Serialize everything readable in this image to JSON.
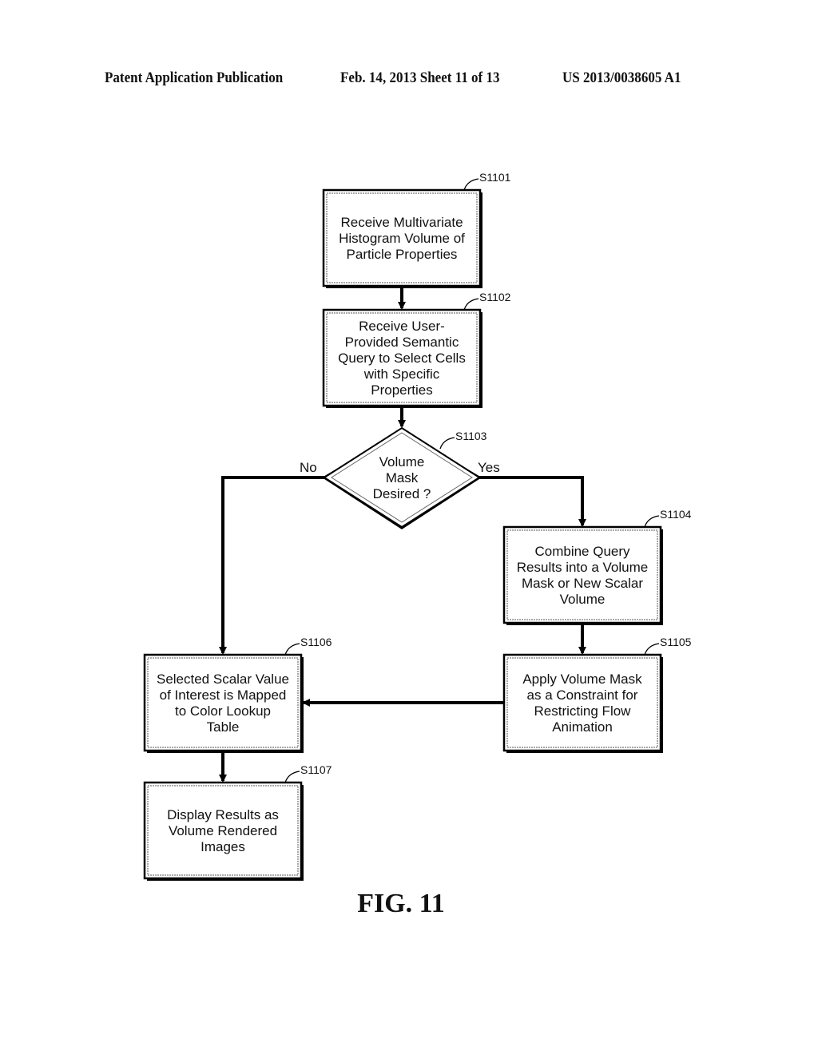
{
  "header": {
    "publication": "Patent Application Publication",
    "date_sheet": "Feb. 14, 2013   Sheet 11 of 13",
    "number": "US 2013/0038605 A1"
  },
  "figure_label": "FIG. 11",
  "steps": [
    {
      "id": "S1101",
      "lines": [
        "Receive Multivariate",
        "Histogram Volume of",
        "Particle Properties"
      ]
    },
    {
      "id": "S1102",
      "lines": [
        "Receive User-",
        "Provided Semantic",
        "Query to Select Cells",
        "with Specific",
        "Properties"
      ]
    },
    {
      "id": "S1103",
      "lines": [
        "Volume",
        "Mask",
        "Desired ?"
      ]
    },
    {
      "id": "S1104",
      "lines": [
        "Combine Query",
        "Results into a Volume",
        "Mask or New Scalar",
        "Volume"
      ]
    },
    {
      "id": "S1105",
      "lines": [
        "Apply Volume Mask",
        "as a Constraint for",
        "Restricting Flow",
        "Animation"
      ]
    },
    {
      "id": "S1106",
      "lines": [
        "Selected Scalar Value",
        "of Interest is Mapped",
        "to Color Lookup",
        "Table"
      ]
    },
    {
      "id": "S1107",
      "lines": [
        "Display Results as",
        "Volume Rendered",
        "Images"
      ]
    }
  ],
  "branches": {
    "no": "No",
    "yes": "Yes"
  },
  "edges": [
    {
      "from": "S1101",
      "to": "S1102"
    },
    {
      "from": "S1102",
      "to": "S1103"
    },
    {
      "from": "S1103",
      "to": "S1104",
      "label": "Yes"
    },
    {
      "from": "S1103",
      "to": "S1106",
      "label": "No"
    },
    {
      "from": "S1104",
      "to": "S1105"
    },
    {
      "from": "S1105",
      "to": "S1106"
    },
    {
      "from": "S1106",
      "to": "S1107"
    }
  ]
}
